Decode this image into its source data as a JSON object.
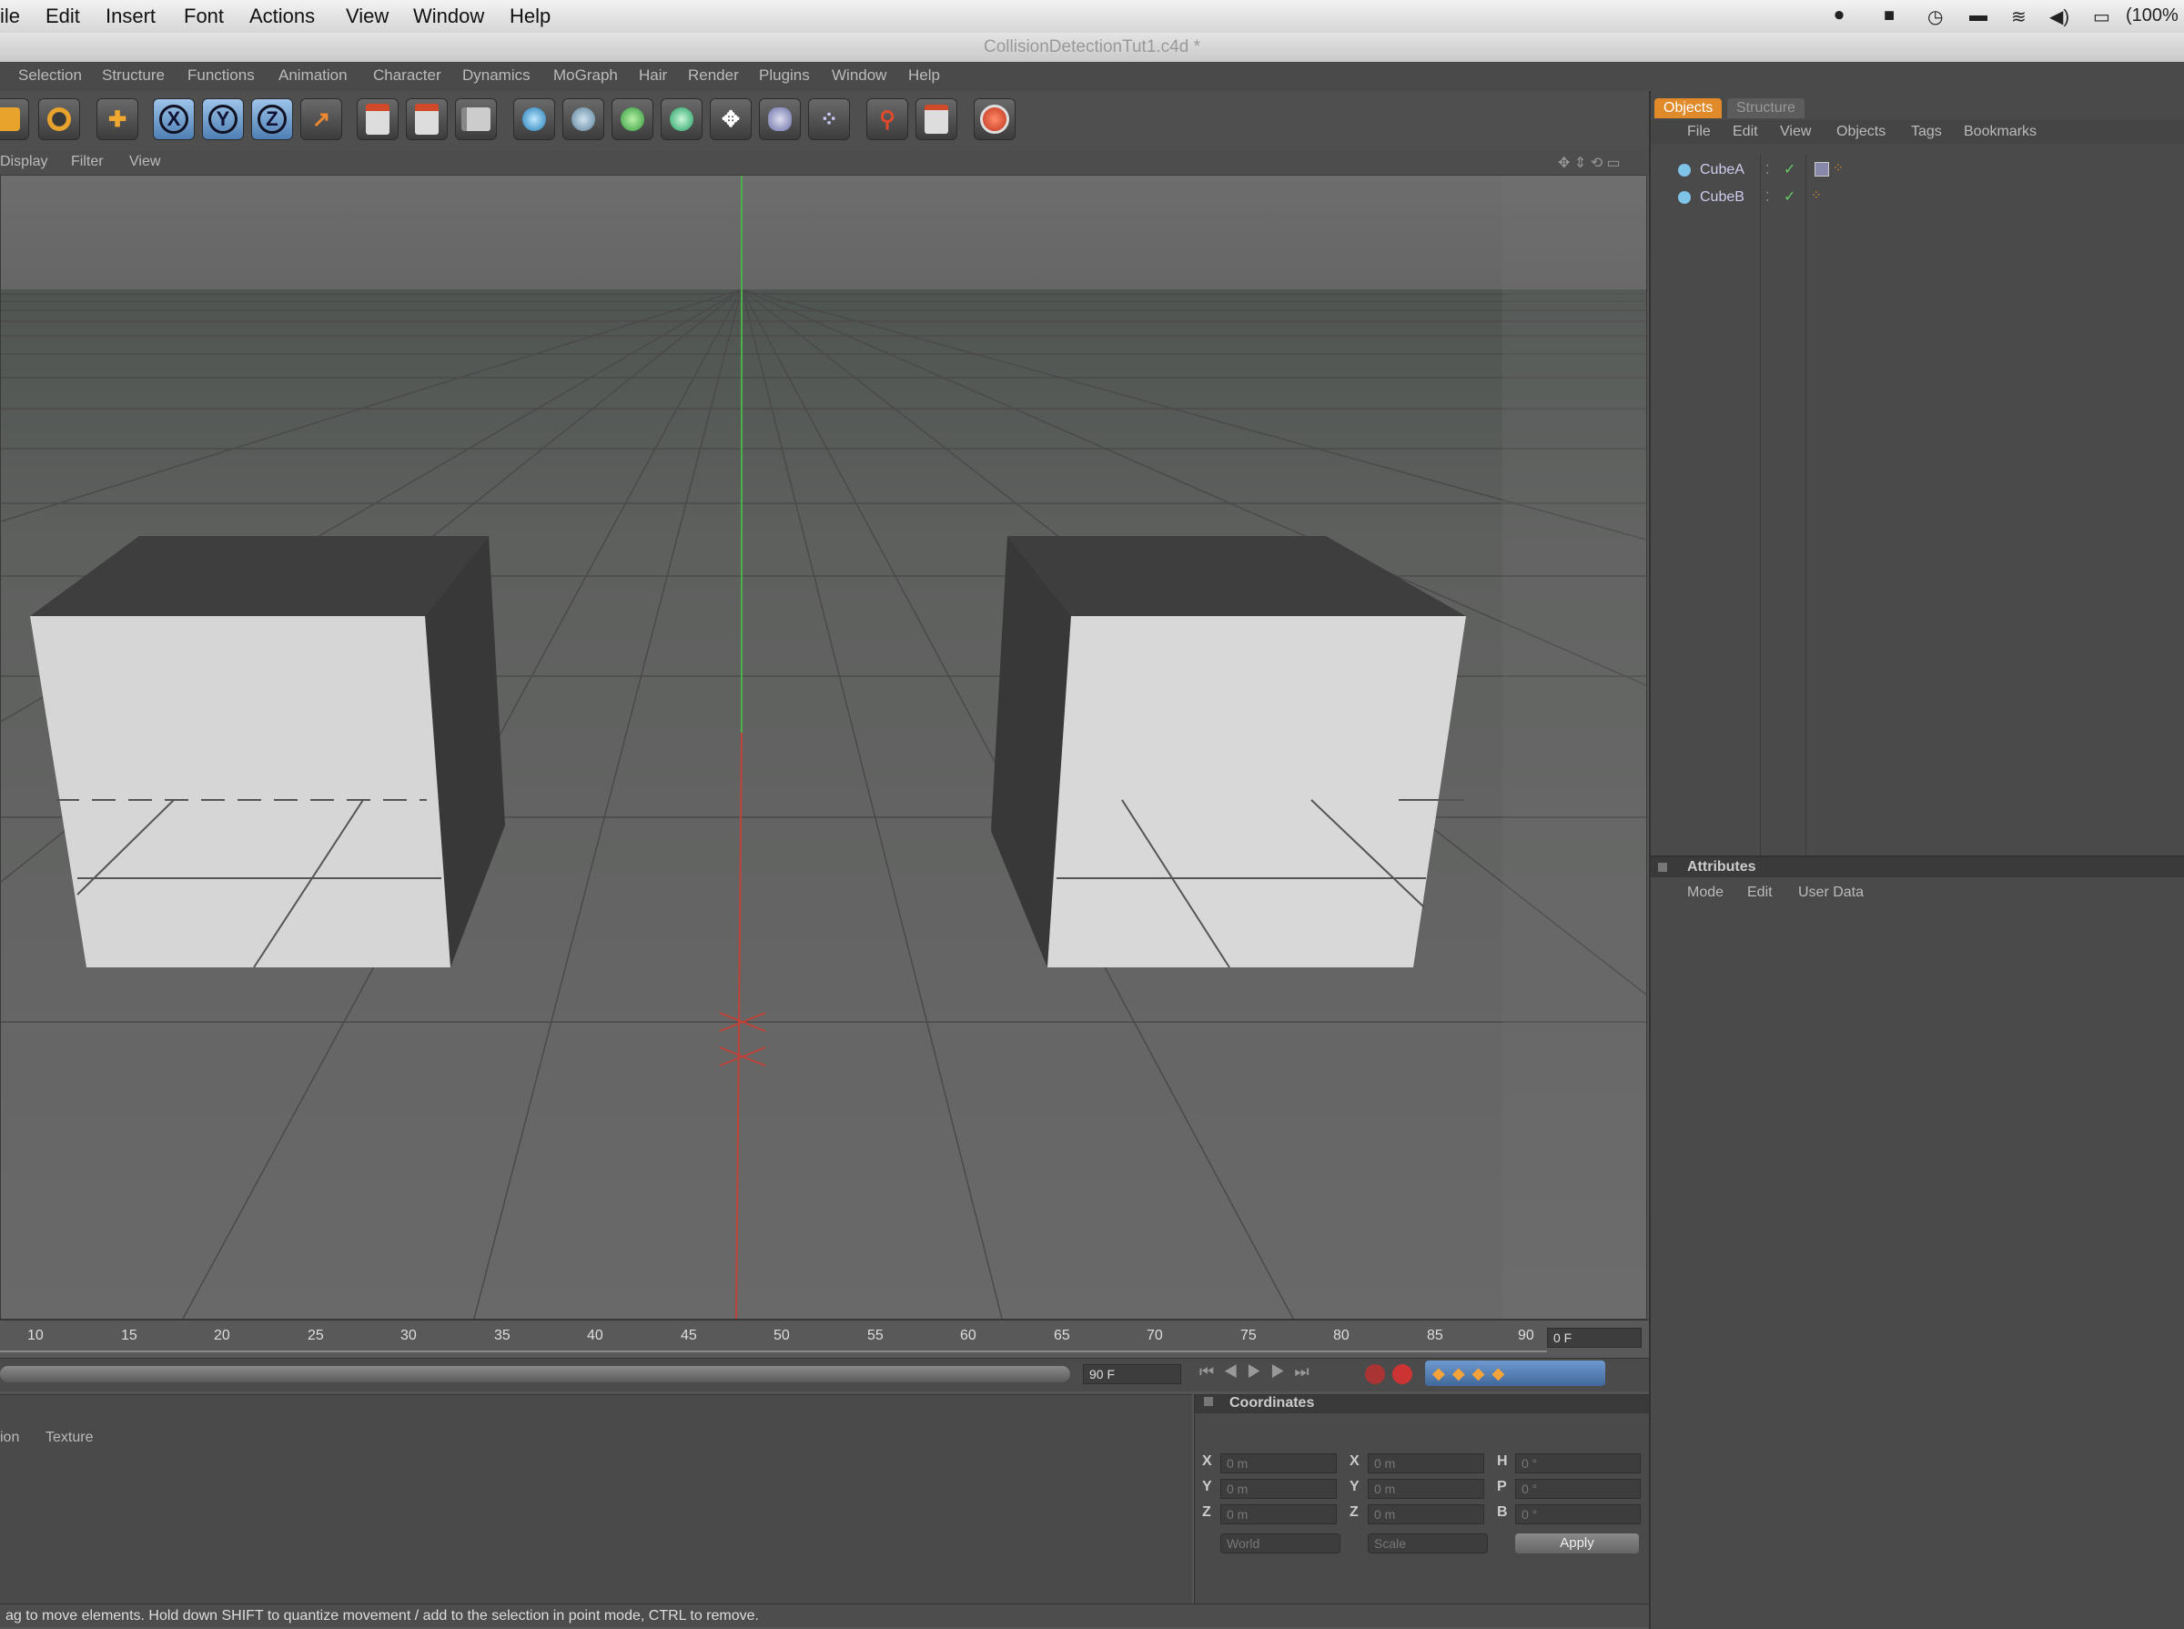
{
  "mac_menu": {
    "items": [
      "ile",
      "Edit",
      "Insert",
      "Font",
      "Actions",
      "View",
      "Window",
      "Help"
    ],
    "battery": "(100%"
  },
  "window": {
    "title": "CollisionDetectionTut1.c4d *"
  },
  "c4d_menu": [
    "Selection",
    "Structure",
    "Functions",
    "Animation",
    "Character",
    "Dynamics",
    "MoGraph",
    "Hair",
    "Render",
    "Plugins",
    "Window",
    "Help"
  ],
  "toolbar": {
    "axis_x": "X",
    "axis_y": "Y",
    "axis_z": "Z"
  },
  "viewport_menu": [
    "Display",
    "Filter",
    "View"
  ],
  "timeline": {
    "ticks": [
      "10",
      "15",
      "20",
      "25",
      "30",
      "35",
      "40",
      "45",
      "50",
      "55",
      "60",
      "65",
      "70",
      "75",
      "80",
      "85",
      "90"
    ],
    "current_frame": "0 F",
    "end_frame": "90 F"
  },
  "bottom_tabs": [
    "ion",
    "Texture"
  ],
  "coordinates": {
    "title": "Coordinates",
    "rows": [
      {
        "axis": "X",
        "pos": "0 m",
        "sizeaxis": "X",
        "size": "0 m",
        "rotaxis": "H",
        "rot": "0 °"
      },
      {
        "axis": "Y",
        "pos": "0 m",
        "sizeaxis": "Y",
        "size": "0 m",
        "rotaxis": "P",
        "rot": "0 °"
      },
      {
        "axis": "Z",
        "pos": "0 m",
        "sizeaxis": "Z",
        "size": "0 m",
        "rotaxis": "B",
        "rot": "0 °"
      }
    ],
    "mode_select": "World",
    "scale_select": "Scale",
    "apply_label": "Apply"
  },
  "status_text": "ag to move elements. Hold down SHIFT to quantize movement / add to the selection in point mode, CTRL to remove.",
  "objects_panel": {
    "tabs": [
      "Objects",
      "Structure"
    ],
    "menu": [
      "File",
      "Edit",
      "View",
      "Objects",
      "Tags",
      "Bookmarks"
    ],
    "objects": [
      "CubeA",
      "CubeB"
    ]
  },
  "attributes_panel": {
    "title": "Attributes",
    "menu": [
      "Mode",
      "Edit",
      "User Data"
    ]
  },
  "colors": {
    "accent_orange": "#e08a2a",
    "axis_blue": "#6f9fd3",
    "viewport_bg": "#6a6a6a"
  }
}
